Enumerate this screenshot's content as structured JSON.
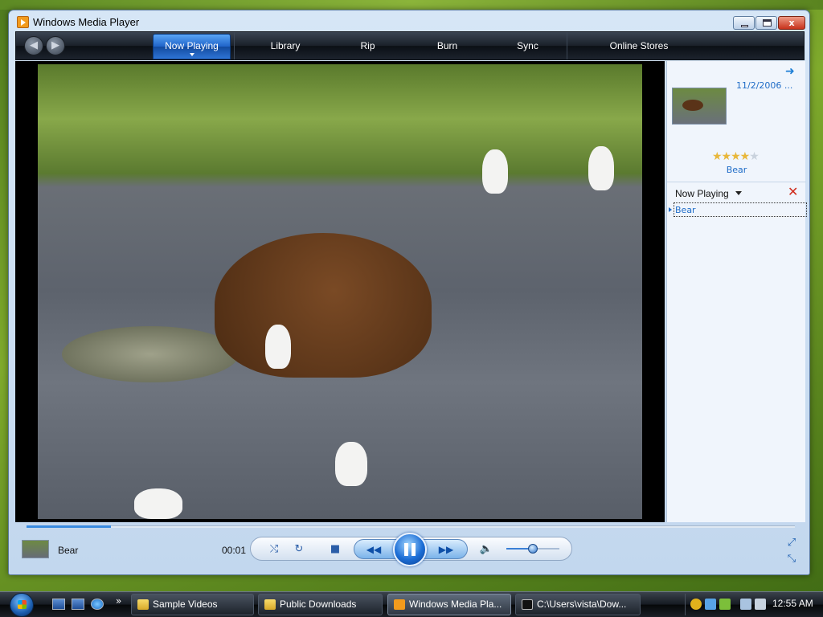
{
  "window": {
    "title": "Windows Media Player",
    "min_label": "",
    "max_label": "",
    "close_label": "x"
  },
  "nav": {
    "back_label": "◀",
    "forward_label": "▶",
    "tabs": [
      {
        "label": "Now Playing",
        "active": true
      },
      {
        "label": "Library",
        "active": false
      },
      {
        "label": "Rip",
        "active": false
      },
      {
        "label": "Burn",
        "active": false
      },
      {
        "label": "Sync",
        "active": false
      },
      {
        "label": "Online Stores",
        "active": false
      }
    ]
  },
  "side_panel": {
    "arrow_icon": "➜",
    "album_date": "11/2/2006 ...",
    "rating": {
      "filled_stars": 4,
      "total_stars": 5,
      "filled_glyph": "★★★★",
      "empty_glyph": "★"
    },
    "album_title": "Bear",
    "list_label": "Now Playing",
    "clear_icon": "✕",
    "playlist": [
      {
        "title": "Bear",
        "playing": true
      }
    ]
  },
  "player": {
    "seek_fraction": 0.11,
    "track_title": "Bear",
    "elapsed": "00:01",
    "shuffle_icon": "⤭",
    "repeat_icon": "↻",
    "stop_icon": "■",
    "prev_icon": "◀◀",
    "next_icon": "▶▶",
    "volume_icon": "🔈",
    "volume_fraction": 0.5,
    "fullscreen_icon": "⤢",
    "compact_icon": "⤡"
  },
  "taskbar": {
    "quicklaunch_more": "»",
    "tasks": [
      {
        "label": "Sample Videos",
        "icon": "folder",
        "active": false
      },
      {
        "label": "Public Downloads",
        "icon": "folder",
        "active": false
      },
      {
        "label": "Windows Media Pla...",
        "icon": "wmp",
        "active": true
      },
      {
        "label": "C:\\Users\\vista\\Dow...",
        "icon": "cmd",
        "active": false
      }
    ],
    "clock": "12:55 AM"
  },
  "colors": {
    "accent": "#1f6cc7",
    "tab_active": "#1f63c8",
    "close_red": "#c7311b"
  }
}
